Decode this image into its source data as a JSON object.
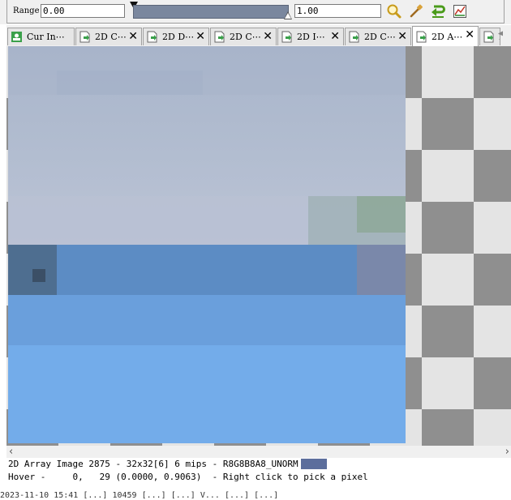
{
  "toolbar": {
    "range_label": "Range",
    "range_min": "0.00",
    "range_max": "1.00",
    "range_bar_color": "#7a879e",
    "buttons": [
      {
        "name": "zoom-icon"
      },
      {
        "name": "pick-icon"
      },
      {
        "name": "auto-fit-icon"
      },
      {
        "name": "histogram-icon"
      }
    ]
  },
  "tabs": [
    {
      "label": "Cur In⋯",
      "icon": "resource-icon",
      "active": false
    },
    {
      "label": "2D C⋯",
      "icon": "texture-icon",
      "active": false
    },
    {
      "label": "2D D⋯",
      "icon": "texture-icon",
      "active": false
    },
    {
      "label": "2D C⋯",
      "icon": "texture-icon",
      "active": false
    },
    {
      "label": "2D I⋯",
      "icon": "texture-icon",
      "active": false
    },
    {
      "label": "2D C⋯",
      "icon": "texture-icon",
      "active": false
    },
    {
      "label": "2D A⋯",
      "icon": "texture-icon",
      "active": true
    },
    {
      "label": "2",
      "icon": "texture-icon",
      "active": false
    }
  ],
  "status": {
    "info": "2D Array Image 2875 - 32x32[6] 6 mips - R8G8B8A8_UNORM",
    "swatch_color": "#5c6e9c",
    "hover": "Hover -     0,   29 (0.0000, 0.9063)  - Right click to pick a pixel"
  },
  "log": {
    "text": "2023-11-10 15:41 [...] 10459 [...] [...] V... [...] [...]"
  }
}
